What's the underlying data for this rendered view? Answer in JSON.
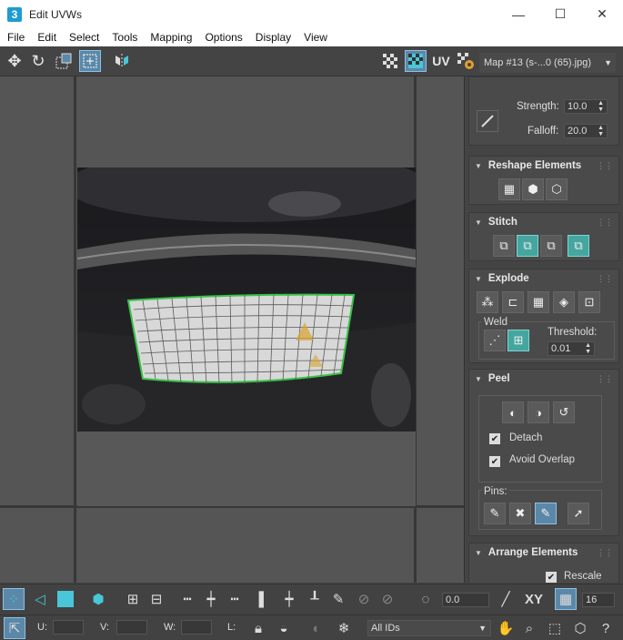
{
  "window": {
    "app_icon": "3",
    "title": "Edit UVWs",
    "minimize": "—",
    "maximize": "☐",
    "close": "✕"
  },
  "menu": [
    "File",
    "Edit",
    "Select",
    "Tools",
    "Mapping",
    "Options",
    "Display",
    "View"
  ],
  "top_toolbar": {
    "uv_label": "UV",
    "map_selector": "Map #13 (s-...0 (65).jpg)"
  },
  "soft_selection": {
    "strength_label": "Strength:",
    "strength_value": "10.0",
    "falloff_label": "Falloff:",
    "falloff_value": "20.0"
  },
  "reshape": {
    "title": "Reshape Elements"
  },
  "stitch": {
    "title": "Stitch"
  },
  "explode": {
    "title": "Explode",
    "weld_label": "Weld",
    "threshold_label": "Threshold:",
    "threshold_value": "0.01"
  },
  "peel": {
    "title": "Peel",
    "detach_label": "Detach",
    "detach_checked": true,
    "avoid_overlap_label": "Avoid Overlap",
    "avoid_overlap_checked": true,
    "pins_label": "Pins:"
  },
  "arrange": {
    "title": "Arrange Elements",
    "rescale_label": "Rescale",
    "rescale_checked": true
  },
  "bottom_toolbar": {
    "spin_value": "0.0",
    "xy_label": "XY",
    "grid_count": "16",
    "u_label": "U:",
    "v_label": "V:",
    "w_label": "W:",
    "l_label": "L:",
    "id_filter": "All IDs"
  },
  "colors": {
    "accent_teal": "#45a6a0",
    "accent_blue": "#5b88a8",
    "uv_border": "#39c24a",
    "panel_bg": "#444444"
  }
}
